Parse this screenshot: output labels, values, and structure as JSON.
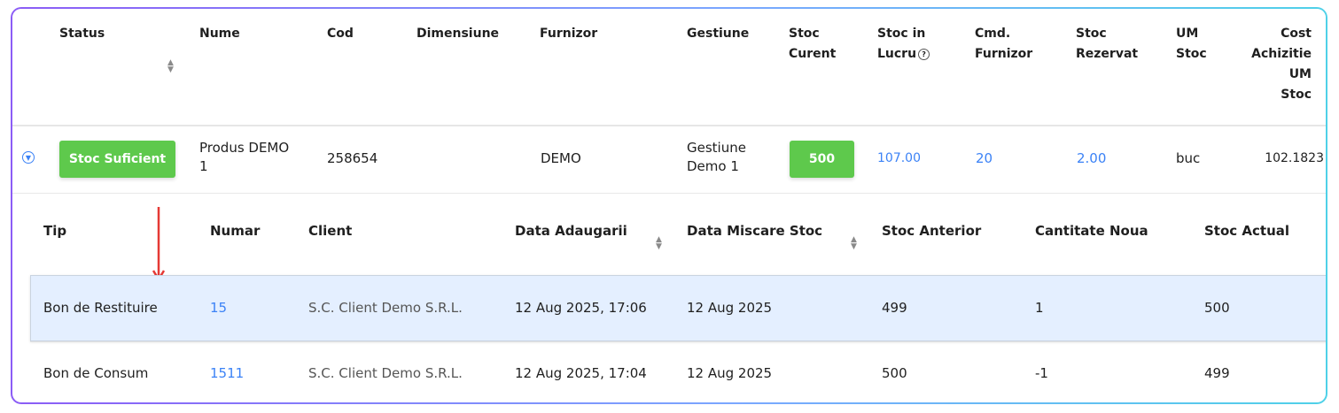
{
  "main_table": {
    "headers": {
      "status": "Status",
      "nume": "Nume",
      "cod": "Cod",
      "dimensiune": "Dimensiune",
      "furnizor": "Furnizor",
      "gestiune": "Gestiune",
      "stoc_curent_1": "Stoc",
      "stoc_curent_2": "Curent",
      "stoc_lucru_1": "Stoc in",
      "stoc_lucru_2": "Lucru",
      "cmd_furnizor_1": "Cmd.",
      "cmd_furnizor_2": "Furnizor",
      "stoc_rezervat_1": "Stoc",
      "stoc_rezervat_2": "Rezervat",
      "um_stoc_1": "UM",
      "um_stoc_2": "Stoc",
      "cost_1": "Cost",
      "cost_2": "Achizitie",
      "cost_3": "UM",
      "cost_4": "Stoc"
    },
    "product": {
      "status_badge": "Stoc Suficient",
      "nume_1": "Produs DEMO",
      "nume_2": "1",
      "cod": "258654",
      "furnizor": "DEMO",
      "gestiune_1": "Gestiune",
      "gestiune_2": "Demo 1",
      "stoc_curent": "500",
      "stoc_in_lucru": "107.00",
      "cmd_furnizor": "20",
      "stoc_rezervat": "2.00",
      "um_stoc": "buc",
      "cost_achizitie": "102.1823"
    }
  },
  "sub_table": {
    "headers": {
      "tip": "Tip",
      "numar": "Numar",
      "client": "Client",
      "data_adaugarii": "Data Adaugarii",
      "data_miscare": "Data Miscare Stoc",
      "stoc_anterior": "Stoc Anterior",
      "cantitate_noua": "Cantitate Noua",
      "stoc_actual": "Stoc Actual"
    },
    "rows": [
      {
        "tip": "Bon de Restituire",
        "numar": "15",
        "client": "S.C. Client Demo S.R.L.",
        "data_adaugarii": "12 Aug 2025, 17:06",
        "data_miscare": "12 Aug 2025",
        "stoc_anterior": "499",
        "cantitate_noua": "1",
        "stoc_actual": "500"
      },
      {
        "tip": "Bon de Consum",
        "numar": "1511",
        "client": "S.C. Client Demo S.R.L.",
        "data_adaugarii": "12 Aug 2025, 17:04",
        "data_miscare": "12 Aug 2025",
        "stoc_anterior": "500",
        "cantitate_noua": "-1",
        "stoc_actual": "499"
      }
    ]
  },
  "colors": {
    "accent_link": "#3b82f6",
    "badge_green": "#5ec94c",
    "selected_row": "#e4efff",
    "annotation_arrow": "#e53935"
  },
  "icons": {
    "expand": "chevron-down-circle-icon",
    "sort": "sort-arrows-icon",
    "help": "question-circle-icon",
    "annotation": "red-arrow-down-icon"
  }
}
